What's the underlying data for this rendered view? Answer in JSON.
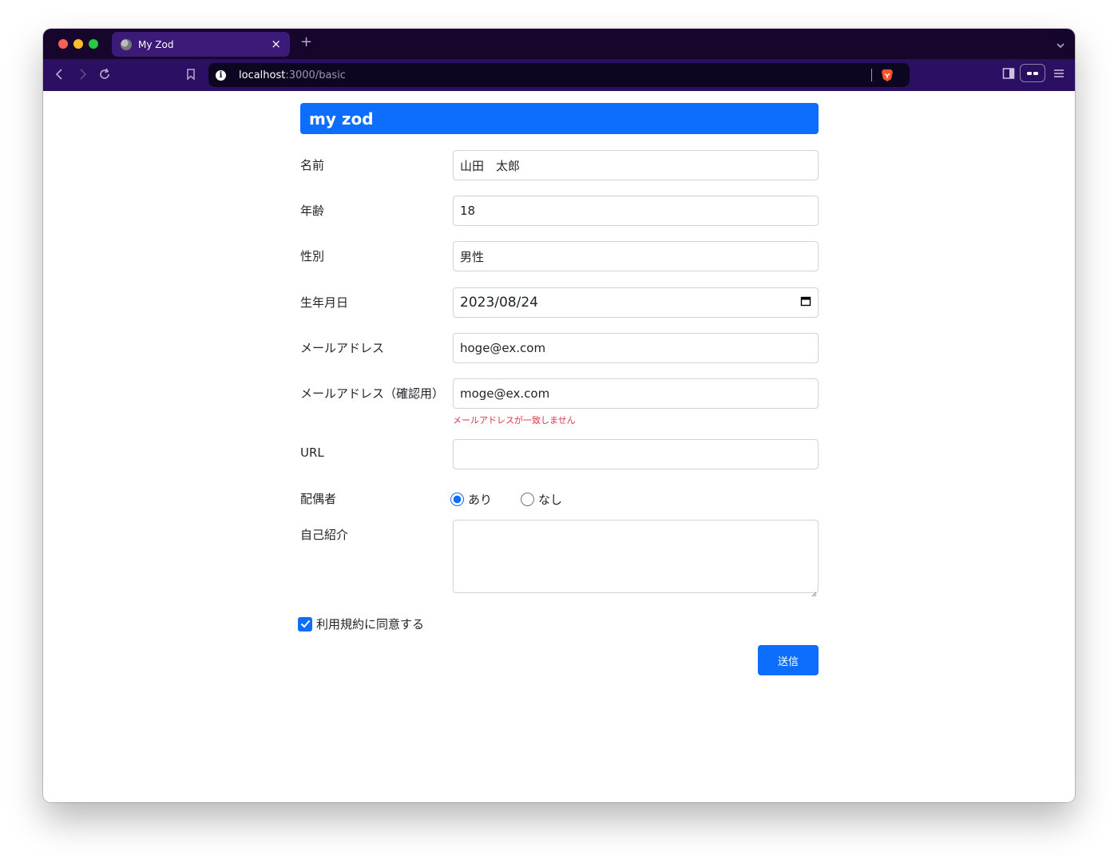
{
  "browser": {
    "tab_title": "My Zod",
    "tab_close": "×",
    "new_tab": "+",
    "url_host": "localhost",
    "url_path": ":3000/basic"
  },
  "form": {
    "header": "my zod",
    "fields": {
      "name": {
        "label": "名前",
        "value": "山田　太郎"
      },
      "age": {
        "label": "年齢",
        "value": "18"
      },
      "gender": {
        "label": "性別",
        "value": "男性"
      },
      "birthdate": {
        "label": "生年月日",
        "value": "2023/08/24"
      },
      "email": {
        "label": "メールアドレス",
        "value": "hoge@ex.com"
      },
      "email_confirm": {
        "label": "メールアドレス（確認用）",
        "value": "moge@ex.com",
        "error": "メールアドレスが一致しません"
      },
      "url": {
        "label": "URL",
        "value": ""
      },
      "spouse": {
        "label": "配偶者",
        "options": [
          "あり",
          "なし"
        ],
        "selected": "あり"
      },
      "intro": {
        "label": "自己紹介",
        "value": ""
      }
    },
    "terms": {
      "label": "利用規約に同意する",
      "checked": true
    },
    "submit_label": "送信"
  },
  "colors": {
    "primary": "#0d6efd",
    "error": "#dc3545",
    "tabbar": "#16062c",
    "toolbar": "#2b0f63"
  }
}
